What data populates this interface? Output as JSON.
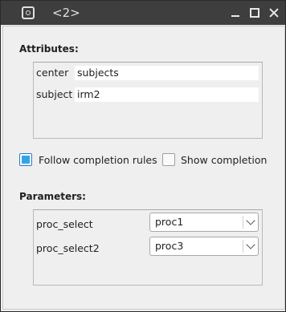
{
  "window": {
    "title": "<2>"
  },
  "attributes": {
    "heading": "Attributes:",
    "rows": [
      {
        "label": "center",
        "value": "subjects"
      },
      {
        "label": "subject",
        "value": "irm2"
      }
    ]
  },
  "options": {
    "follow_completion": {
      "label": "Follow completion rules",
      "checked": true
    },
    "show_completion": {
      "label": "Show completion",
      "checked": false
    }
  },
  "parameters": {
    "heading": "Parameters:",
    "rows": [
      {
        "label": "proc_select",
        "value": "proc1"
      },
      {
        "label": "proc_select2",
        "value": "proc3"
      }
    ]
  },
  "icons": [
    "app-icon",
    "minimize-icon",
    "maximize-icon",
    "close-icon",
    "chevron-down-icon"
  ],
  "colors": {
    "titlebar": "#3e3e3e",
    "checkbox_accent": "#34a4e8",
    "background": "#efefef"
  }
}
